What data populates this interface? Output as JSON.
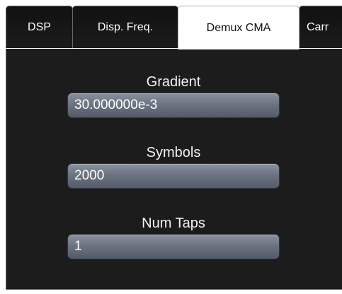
{
  "tabs": [
    {
      "label": "DSP",
      "active": false
    },
    {
      "label": "Disp. Freq.",
      "active": false
    },
    {
      "label": "Demux CMA",
      "active": true
    },
    {
      "label": "Carr",
      "active": false
    }
  ],
  "fields": {
    "gradient": {
      "label": "Gradient",
      "value": "30.000000e-3"
    },
    "symbols": {
      "label": "Symbols",
      "value": "2000"
    },
    "num_taps": {
      "label": "Num Taps",
      "value": "1"
    }
  },
  "colors": {
    "panel_background": "#1c1c1c",
    "active_tab": "#ffffff",
    "input_gradient_top": "#8a919e",
    "input_gradient_bottom": "#545b68"
  }
}
